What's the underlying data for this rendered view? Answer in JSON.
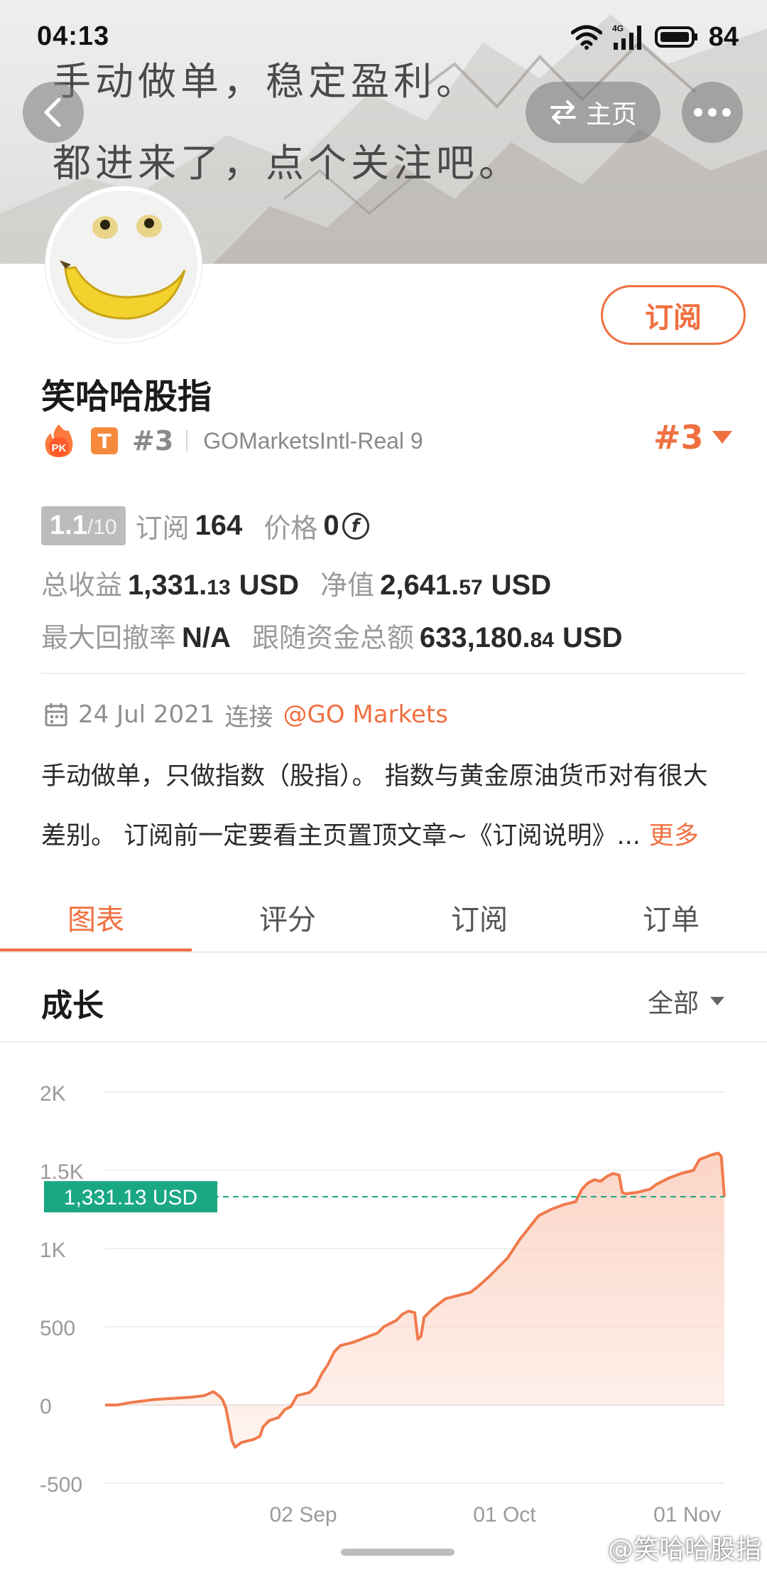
{
  "status_bar": {
    "time": "04:13",
    "network": "4G",
    "battery": "84"
  },
  "banner": {
    "line1": "手动做单，稳定盈利。",
    "line2": "都进来了，点个关注吧。"
  },
  "nav": {
    "home_label": "主页"
  },
  "profile": {
    "subscribe_label": "订阅",
    "name": "笑哈哈股指",
    "pk_label": "PK",
    "t_label": "T",
    "rank_small": "#3",
    "broker": "GOMarketsIntl-Real 9",
    "rank_big": "#3"
  },
  "stats": {
    "score_main": "1.1",
    "score_total": "/10",
    "subscribe_label": "订阅",
    "subscribe_count": "164",
    "price_label": "价格",
    "price_value": "0",
    "coin_symbol": "f",
    "total_profit_label": "总收益",
    "total_profit_int": "1,331.",
    "total_profit_dec": "13",
    "total_profit_unit": "USD",
    "net_value_label": "净值",
    "net_value_int": "2,641.",
    "net_value_dec": "57",
    "net_value_unit": "USD",
    "max_drawdown_label": "最大回撤率",
    "max_drawdown_value": "N/A",
    "follow_funds_label": "跟随资金总额",
    "follow_funds_int": "633,180.",
    "follow_funds_dec": "84",
    "follow_funds_unit": "USD"
  },
  "connect": {
    "date": "24 Jul 2021",
    "label": "连接",
    "link": "@GO Markets"
  },
  "description": {
    "line1": "手动做单，只做指数（股指）。 指数与黄金原油货币对有很大",
    "line2": "差别。 订阅前一定要看主页置顶文章~《订阅说明》...",
    "more": "更多"
  },
  "tabs": [
    {
      "label": "图表",
      "active": true
    },
    {
      "label": "评分",
      "active": false
    },
    {
      "label": "订阅",
      "active": false
    },
    {
      "label": "订单",
      "active": false
    }
  ],
  "section": {
    "title": "成长",
    "filter": "全部"
  },
  "colors": {
    "accent": "#f07040",
    "marker": "#1aa884",
    "line": "#f07a4c",
    "fill": "#fcd3c3"
  },
  "chart_data": {
    "type": "area",
    "yticks": [
      "2K",
      "1.5K",
      "1K",
      "500",
      "0",
      "-500"
    ],
    "yvalues": [
      2000,
      1500,
      1000,
      500,
      0,
      -500
    ],
    "ylim": [
      -500,
      2000
    ],
    "xticks": [
      "02 Sep",
      "01 Oct",
      "01 Nov"
    ],
    "current_value": 1331.13,
    "current_label": "1,331.13 USD",
    "series": [
      {
        "points": [
          [
            0,
            0
          ],
          [
            0.02,
            0
          ],
          [
            0.04,
            15
          ],
          [
            0.06,
            25
          ],
          [
            0.08,
            35
          ],
          [
            0.1,
            40
          ],
          [
            0.12,
            45
          ],
          [
            0.14,
            50
          ],
          [
            0.16,
            60
          ],
          [
            0.175,
            85
          ],
          [
            0.185,
            55
          ],
          [
            0.19,
            30
          ],
          [
            0.195,
            -20
          ],
          [
            0.2,
            -120
          ],
          [
            0.205,
            -230
          ],
          [
            0.21,
            -270
          ],
          [
            0.22,
            -240
          ],
          [
            0.23,
            -230
          ],
          [
            0.24,
            -220
          ],
          [
            0.25,
            -200
          ],
          [
            0.255,
            -140
          ],
          [
            0.265,
            -100
          ],
          [
            0.28,
            -80
          ],
          [
            0.29,
            -30
          ],
          [
            0.3,
            -10
          ],
          [
            0.31,
            60
          ],
          [
            0.33,
            80
          ],
          [
            0.34,
            120
          ],
          [
            0.35,
            200
          ],
          [
            0.36,
            260
          ],
          [
            0.37,
            340
          ],
          [
            0.38,
            380
          ],
          [
            0.4,
            400
          ],
          [
            0.42,
            430
          ],
          [
            0.44,
            460
          ],
          [
            0.45,
            500
          ],
          [
            0.47,
            540
          ],
          [
            0.48,
            580
          ],
          [
            0.49,
            600
          ],
          [
            0.5,
            590
          ],
          [
            0.505,
            420
          ],
          [
            0.51,
            440
          ],
          [
            0.515,
            560
          ],
          [
            0.53,
            620
          ],
          [
            0.55,
            680
          ],
          [
            0.57,
            700
          ],
          [
            0.59,
            720
          ],
          [
            0.6,
            750
          ],
          [
            0.62,
            820
          ],
          [
            0.64,
            900
          ],
          [
            0.65,
            940
          ],
          [
            0.66,
            1000
          ],
          [
            0.67,
            1060
          ],
          [
            0.68,
            1110
          ],
          [
            0.69,
            1160
          ],
          [
            0.7,
            1210
          ],
          [
            0.72,
            1250
          ],
          [
            0.74,
            1280
          ],
          [
            0.76,
            1300
          ],
          [
            0.77,
            1380
          ],
          [
            0.78,
            1420
          ],
          [
            0.79,
            1440
          ],
          [
            0.8,
            1430
          ],
          [
            0.81,
            1460
          ],
          [
            0.82,
            1480
          ],
          [
            0.83,
            1470
          ],
          [
            0.835,
            1360
          ],
          [
            0.84,
            1350
          ],
          [
            0.86,
            1360
          ],
          [
            0.88,
            1380
          ],
          [
            0.89,
            1410
          ],
          [
            0.91,
            1450
          ],
          [
            0.93,
            1480
          ],
          [
            0.95,
            1500
          ],
          [
            0.96,
            1570
          ],
          [
            0.98,
            1600
          ],
          [
            0.99,
            1610
          ],
          [
            0.995,
            1590
          ],
          [
            1.0,
            1331
          ]
        ]
      }
    ]
  },
  "watermark": "@笑哈哈股指"
}
